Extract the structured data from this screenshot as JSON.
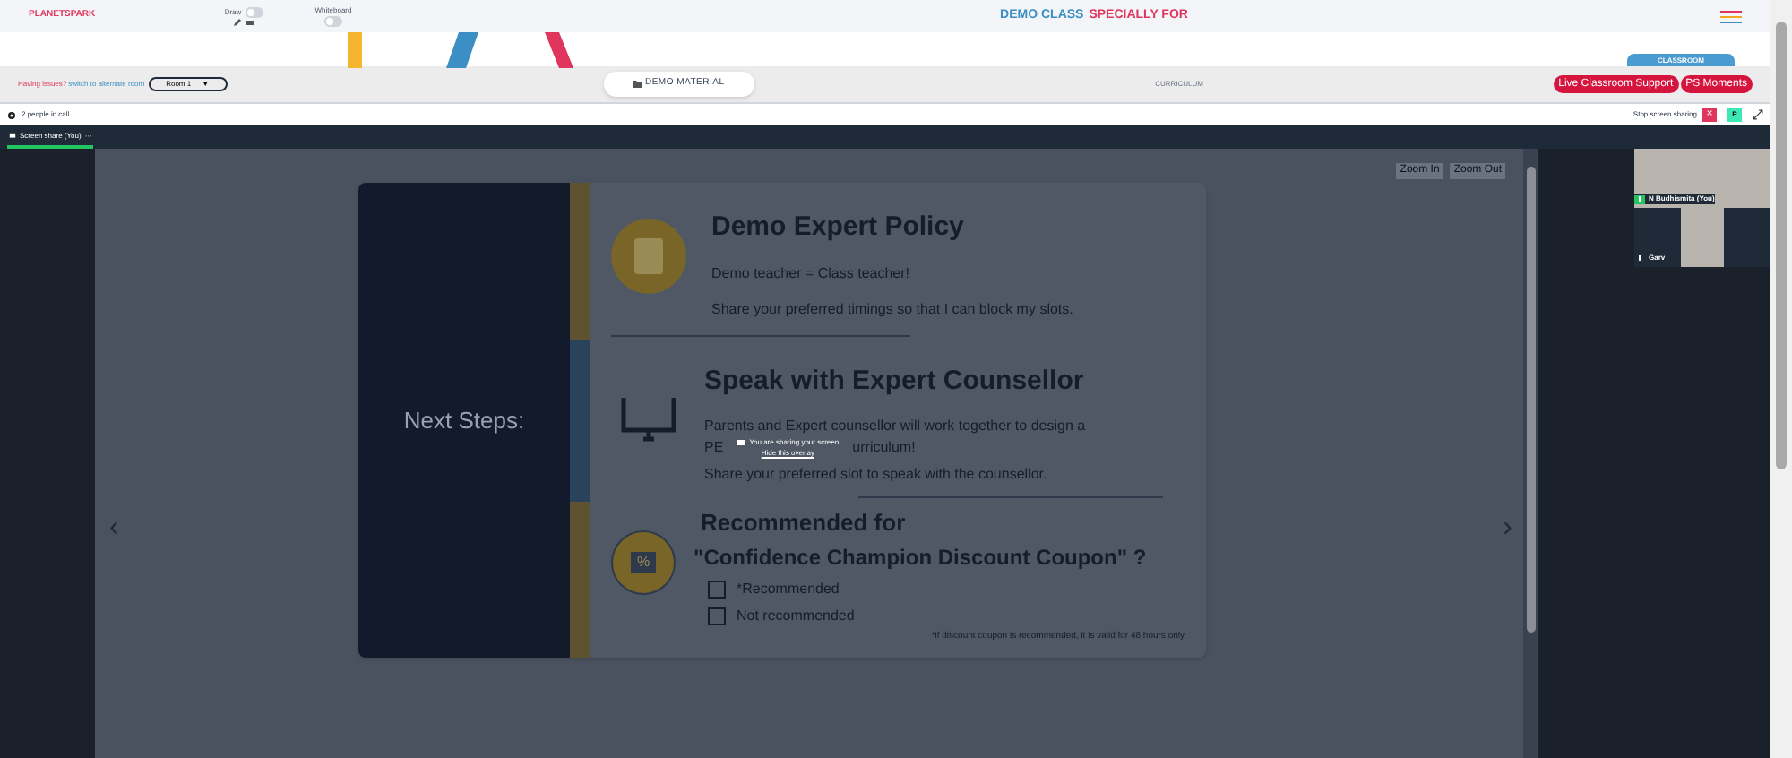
{
  "header": {
    "logo": "PLANETSPARK",
    "draw": {
      "label": "Draw",
      "on": false
    },
    "whiteboard": {
      "label": "Whiteboard",
      "on": false
    },
    "title": {
      "part1": "DEMO CLASS",
      "part2": "SPECIALLY FOR"
    }
  },
  "toolbar": {
    "issue_text": "Having issues?",
    "switch_link": "switch to alternate room",
    "room": "Room 1",
    "room_caret": "▼",
    "demo_material": "DEMO MATERIAL",
    "curriculum": "CURRICULUM",
    "classroom_tab": "CLASSROOM",
    "buttons": [
      "Live Classroom Support",
      "PS Moments"
    ]
  },
  "call_bar": {
    "people": "2 people in call",
    "stop_sharing": "Stop screen sharing",
    "close": "×",
    "p_button": "P"
  },
  "tabs": [
    {
      "label": "Screen share (You)",
      "selected": true,
      "more": "···"
    }
  ],
  "viewer": {
    "zoom_in": "Zoom In",
    "zoom_out": "Zoom Out",
    "prev": "‹",
    "next": "›"
  },
  "slide": {
    "side_title": "Next Steps:",
    "sections": [
      {
        "heading": "Demo Expert Policy",
        "lines": [
          "Demo teacher = Class teacher!",
          "Share your preferred timings so that I can block my slots."
        ]
      },
      {
        "heading": "Speak with Expert Counsellor",
        "lines": [
          "Parents and Expert counsellor will work together to design a"
        ],
        "covered_line": [
          "PE",
          "urriculum!"
        ],
        "last_line": "Share your preferred slot to speak with the counsellor."
      }
    ],
    "recommend": {
      "heading1": "Recommended for",
      "heading2": "\"Confidence Champion Discount Coupon\" ?",
      "icon_text": "%",
      "options": [
        {
          "label": "*Recommended",
          "checked": false
        },
        {
          "label": "Not recommended",
          "checked": false
        }
      ],
      "footnote": "*if discount coupon is recommended, it is valid for 48 hours only"
    }
  },
  "overlay": {
    "message": "You are sharing your screen",
    "link": "Hide this overlay"
  },
  "participants": [
    {
      "name": "N Budhismita (You)",
      "selected": true
    },
    {
      "name": "Garv",
      "selected": false
    }
  ]
}
